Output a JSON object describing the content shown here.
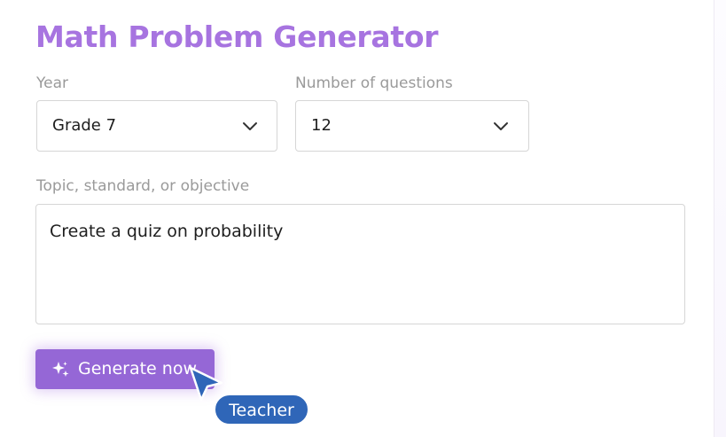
{
  "app": {
    "title": "Math Problem Generator"
  },
  "form": {
    "year": {
      "label": "Year",
      "value": "Grade 7"
    },
    "questions": {
      "label": "Number of questions",
      "value": "12"
    },
    "topic": {
      "label": "Topic, standard, or objective",
      "value": "Create a quiz on probability"
    },
    "generate_label": "Generate now"
  },
  "cursor_badge": {
    "label": "Teacher"
  },
  "colors": {
    "title": "#a774e0",
    "button": "#9567d6",
    "badge": "#2f66b8",
    "label": "#9a9a9a",
    "border": "#d6d6d6"
  },
  "icons": {
    "dropdown": "chevron-down-icon",
    "generate": "sparkle-icon",
    "cursor": "pointer-cursor-icon"
  }
}
